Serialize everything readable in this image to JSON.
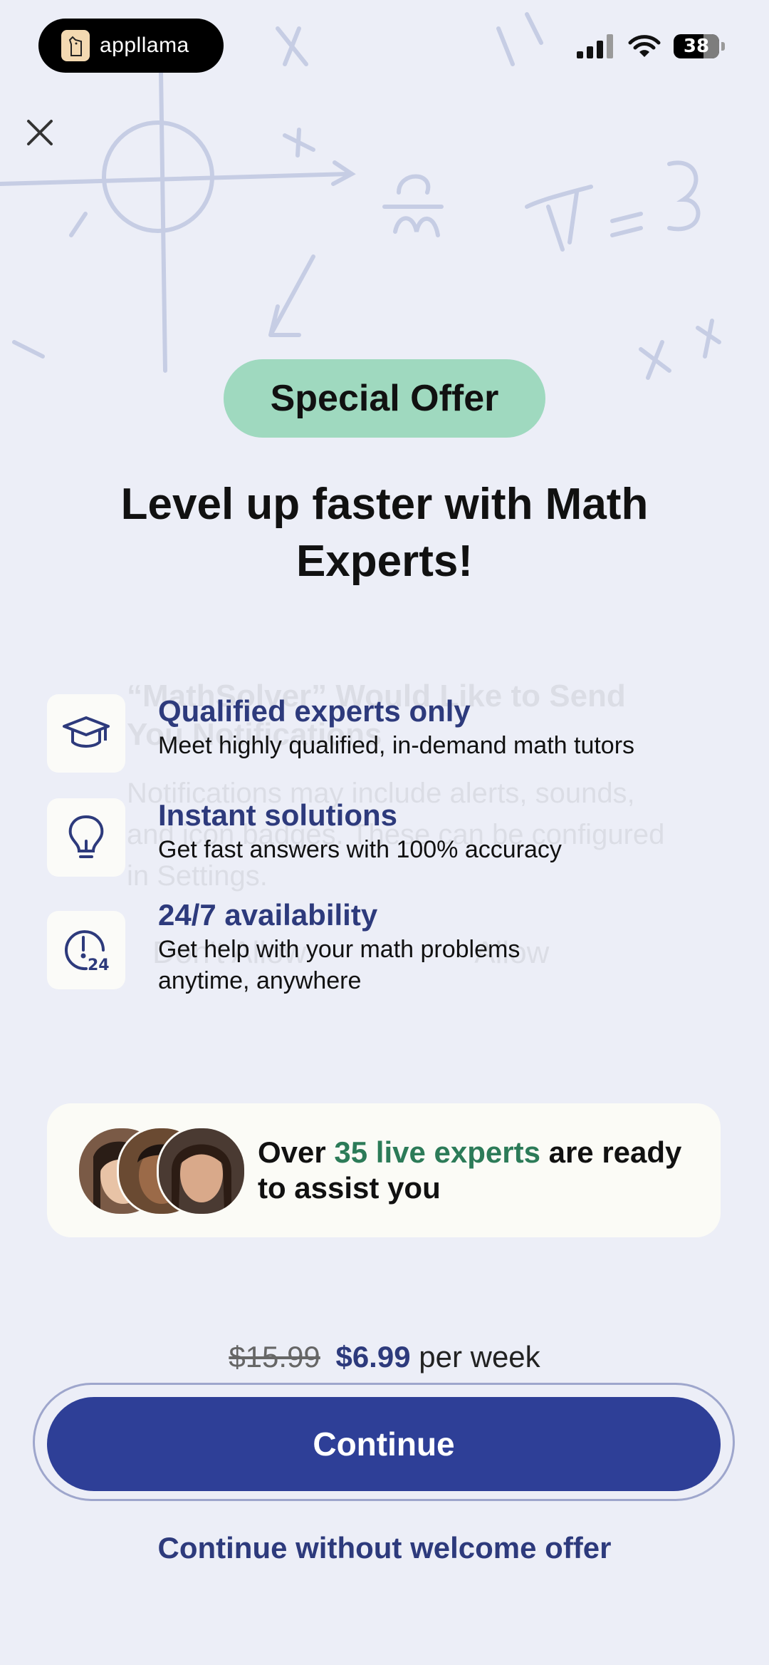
{
  "status_bar": {
    "app_name": "appllama",
    "battery_level": "38"
  },
  "offer_badge": "Special Offer",
  "headline": "Level up faster with Math Experts!",
  "features": [
    {
      "icon": "graduation-cap-icon",
      "title": "Qualified experts only",
      "description": "Meet highly qualified, in-demand math tutors"
    },
    {
      "icon": "lightbulb-icon",
      "title": "Instant solutions",
      "description": "Get fast answers with 100% accuracy"
    },
    {
      "icon": "clock-24-icon",
      "title": "24/7 availability",
      "description": "Get help with your math problems anytime, anywhere"
    }
  ],
  "experts_card": {
    "prefix": "Over ",
    "highlight": "35 live experts",
    "suffix": " are ready to assist you"
  },
  "pricing": {
    "old_price": "$15.99",
    "new_price": "$6.99",
    "period": "per week"
  },
  "cta_label": "Continue",
  "secondary_label": "Continue without welcome offer",
  "ghost_dialog": {
    "title": "“MathSolver” Would Like to Send You Notifications",
    "body": "Notifications may include alerts, sounds, and icon badges. These can be configured in Settings.",
    "deny": "Don't Allow",
    "allow": "Allow"
  },
  "colors": {
    "accent": "#2e3f97",
    "badge": "#9fd9bf",
    "highlight_green": "#2c7b58",
    "background": "#eceef7"
  }
}
